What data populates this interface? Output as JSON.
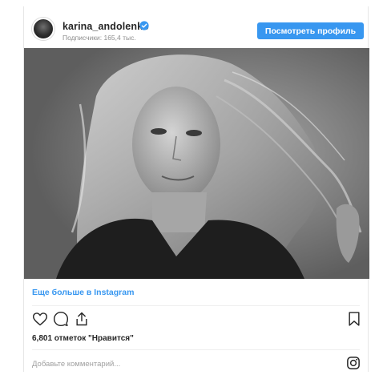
{
  "header": {
    "username": "karina_andolenko",
    "followers": "Подписчики: 165,4 тыс.",
    "view_profile_label": "Посмотреть профиль"
  },
  "post": {
    "more_link": "Еще больше в Instagram",
    "likes": "6,801 отметок \"Нравится\""
  },
  "comment": {
    "placeholder": "Добавьте комментарий..."
  },
  "colors": {
    "accent": "#3897f0",
    "text": "#262626",
    "muted": "#8e8e8e"
  },
  "icons": [
    "verified-badge-icon",
    "heart-icon",
    "comment-icon",
    "share-icon",
    "bookmark-icon",
    "instagram-glyph-icon"
  ]
}
